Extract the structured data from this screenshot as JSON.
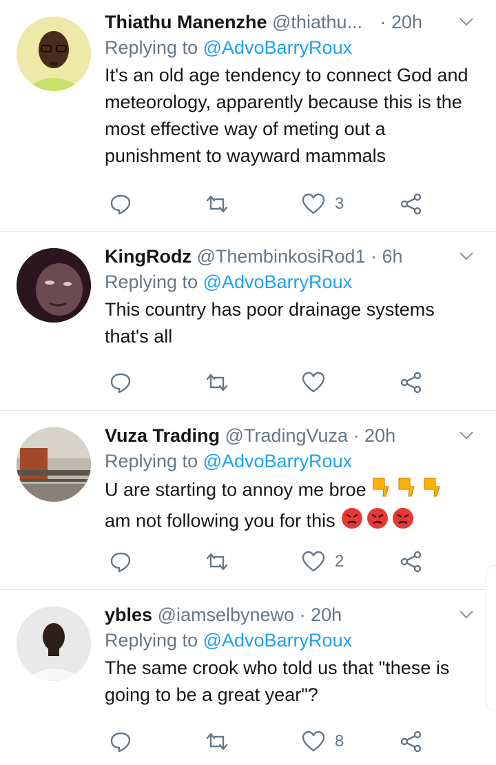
{
  "tweets": [
    {
      "name": "Thiathu Manenzhe",
      "handle": "@thiathu...",
      "time": "· 20h",
      "replying_prefix": "Replying to ",
      "replying_to": "@AdvoBarryRoux",
      "text": "It's an old age tendency to connect God and meteorology, apparently because this is the most effective way of meting out a punishment to wayward mammals",
      "likes": "3"
    },
    {
      "name": "KingRodz",
      "handle": "@ThembinkosiRod1",
      "time": "· 6h",
      "replying_prefix": "Replying to ",
      "replying_to": "@AdvoBarryRoux",
      "text": "This country has poor drainage systems that's all",
      "likes": ""
    },
    {
      "name": "Vuza Trading",
      "handle": "@TradingVuza",
      "time": "· 20h",
      "replying_prefix": "Replying to ",
      "replying_to": "@AdvoBarryRoux",
      "text_line1": "U are starting to annoy me broe",
      "text_line2": "am not following you for this",
      "emoji1": "thumbs-down x3",
      "emoji2": "angry-face x3",
      "likes": "2"
    },
    {
      "name": "ybles",
      "handle": "@iamselbynewo",
      "time": "· 20h",
      "replying_prefix": "Replying to ",
      "replying_to": "@AdvoBarryRoux",
      "text": "The same crook who told us that \"these is going to be a great year\"?",
      "likes": "8"
    }
  ],
  "colors": {
    "accent": "#1da1f2",
    "secondary_text": "#657786",
    "like_red": "#e0245e",
    "divider": "#e1e8ed"
  }
}
